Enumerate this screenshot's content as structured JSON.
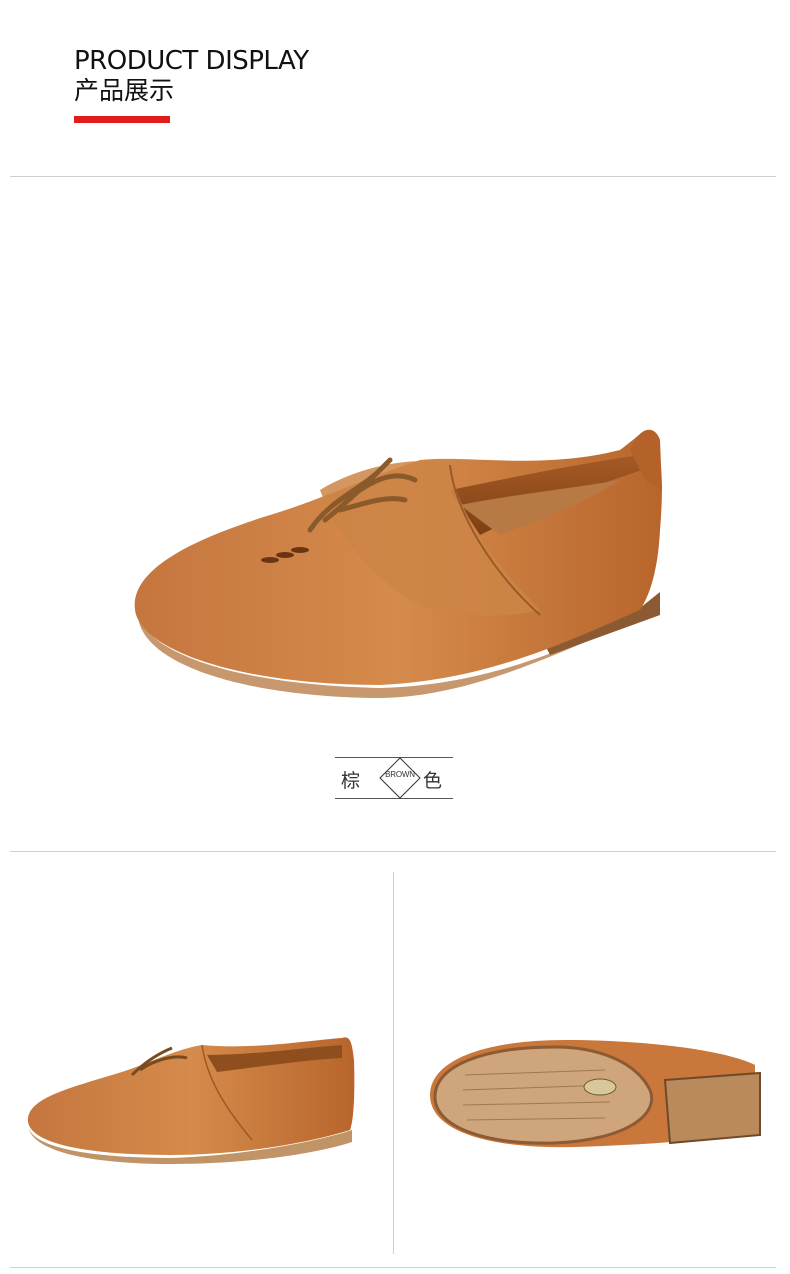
{
  "header": {
    "title_en": "PRODUCT DISPLAY",
    "title_cn": "产品展示",
    "accent_color": "#e01c1c"
  },
  "color_tag": {
    "left_char": "棕",
    "label_en": "BROWN",
    "right_char": "色"
  },
  "images": {
    "main": "brown-leather-lace-up-loafer-side-view",
    "left_small": "brown-leather-loafer-side-view",
    "right_small": "brown-leather-loafer-sole-view"
  },
  "colors": {
    "shoe_leather": "#c9773a",
    "sole": "#c9a27c",
    "rule": "#cfcfcf"
  }
}
